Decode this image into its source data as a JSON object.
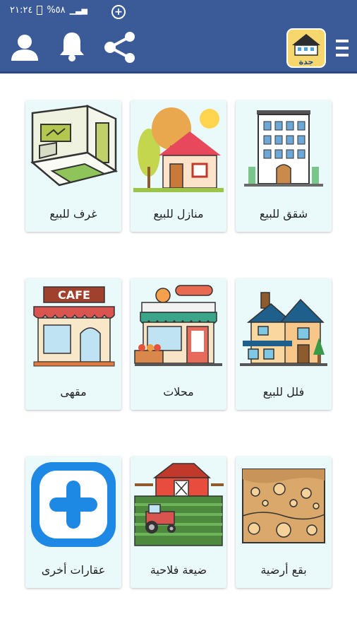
{
  "status": {
    "time": "٢١:٢٤",
    "battery": "%٥٨"
  },
  "header": {
    "logo_text": "جدة",
    "menu_icon": "hamburger-menu-icon",
    "share_icon": "share-icon",
    "bell_icon": "bell-icon",
    "profile_icon": "user-icon"
  },
  "tiles": [
    {
      "label": "شقق للبيع",
      "icon": "apartment-building-icon"
    },
    {
      "label": "منازل للبيع",
      "icon": "house-icon"
    },
    {
      "label": "غرف للبيع",
      "icon": "room-icon"
    },
    {
      "label": "فلل للبيع",
      "icon": "villa-icon"
    },
    {
      "label": "محلات",
      "icon": "shop-icon"
    },
    {
      "label": "مقهى",
      "icon": "cafe-icon"
    },
    {
      "label": "بقع أرضية",
      "icon": "land-plot-icon"
    },
    {
      "label": "ضيعة فلاحية",
      "icon": "farm-icon"
    },
    {
      "label": "عقارات أخرى",
      "icon": "add-other-icon"
    }
  ],
  "cafe_sign": "CAFE",
  "colors": {
    "primary": "#3a5a98",
    "card_bg": "#eafafb"
  }
}
